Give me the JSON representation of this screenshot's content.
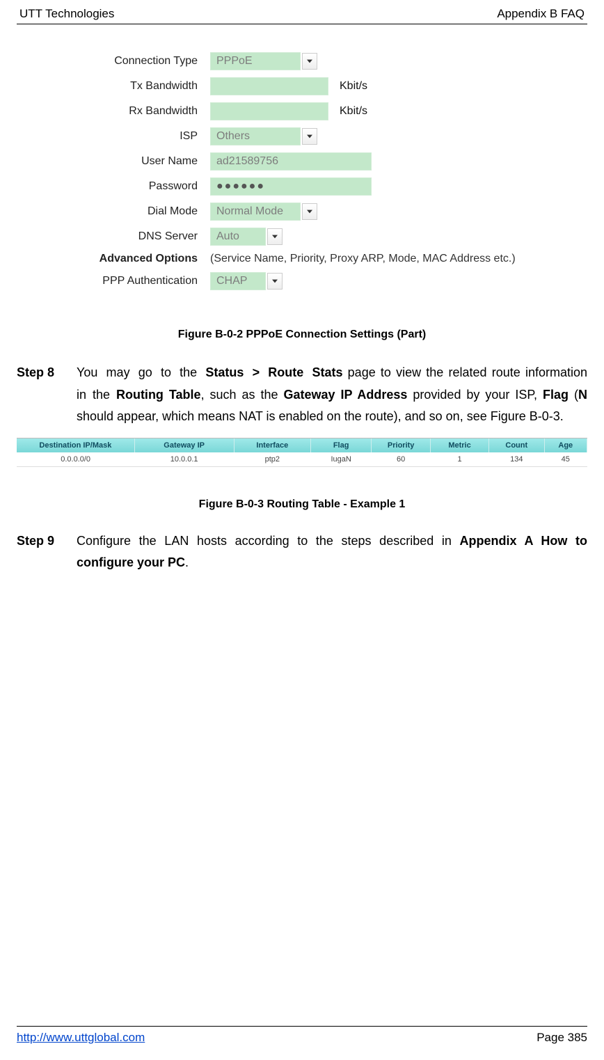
{
  "header": {
    "left": "UTT Technologies",
    "right": "Appendix B FAQ"
  },
  "form": {
    "connection_type": {
      "label": "Connection Type",
      "value": "PPPoE"
    },
    "tx_bw": {
      "label": "Tx Bandwidth",
      "unit": "Kbit/s"
    },
    "rx_bw": {
      "label": "Rx Bandwidth",
      "unit": "Kbit/s"
    },
    "isp": {
      "label": "ISP",
      "value": "Others"
    },
    "user": {
      "label": "User Name",
      "value": "ad21589756"
    },
    "pass": {
      "label": "Password",
      "value": "●●●●●●"
    },
    "dial": {
      "label": "Dial Mode",
      "value": "Normal Mode"
    },
    "dns": {
      "label": "DNS Server",
      "value": "Auto"
    },
    "adv": {
      "label": "Advanced Options",
      "text": "(Service Name, Priority, Proxy ARP, Mode, MAC Address etc.)"
    },
    "ppp_auth": {
      "label": "PPP Authentication",
      "value": "CHAP"
    }
  },
  "figcap1": "Figure B-0-2 PPPoE Connection Settings (Part)",
  "step8": {
    "label": "Step 8",
    "t1": "You may go to the ",
    "b1": "Status > Route Stats",
    "t2": " page to view the related route information in the ",
    "b2": "Routing Table",
    "t3": ", such as the ",
    "b3": "Gateway IP Address",
    "t4": " provided by your ISP, ",
    "b4": "Flag",
    "t5": " (",
    "b5": "N",
    "t6": " should appear, which means NAT is enabled on the route), and so on, see Figure B-0-3."
  },
  "rt": {
    "headers": [
      "Destination IP/Mask",
      "Gateway IP",
      "Interface",
      "Flag",
      "Priority",
      "Metric",
      "Count",
      "Age"
    ],
    "row": [
      "0.0.0.0/0",
      "10.0.0.1",
      "ptp2",
      "IugaN",
      "60",
      "1",
      "134",
      "45"
    ]
  },
  "figcap2": "Figure B-0-3 Routing Table - Example 1",
  "step9": {
    "label": "Step 9",
    "t1": "Configure the LAN hosts according to the steps described in ",
    "b1": "Appendix A How to configure your PC",
    "t2": "."
  },
  "footer": {
    "url": "http://www.uttglobal.com",
    "page": "Page 385"
  }
}
